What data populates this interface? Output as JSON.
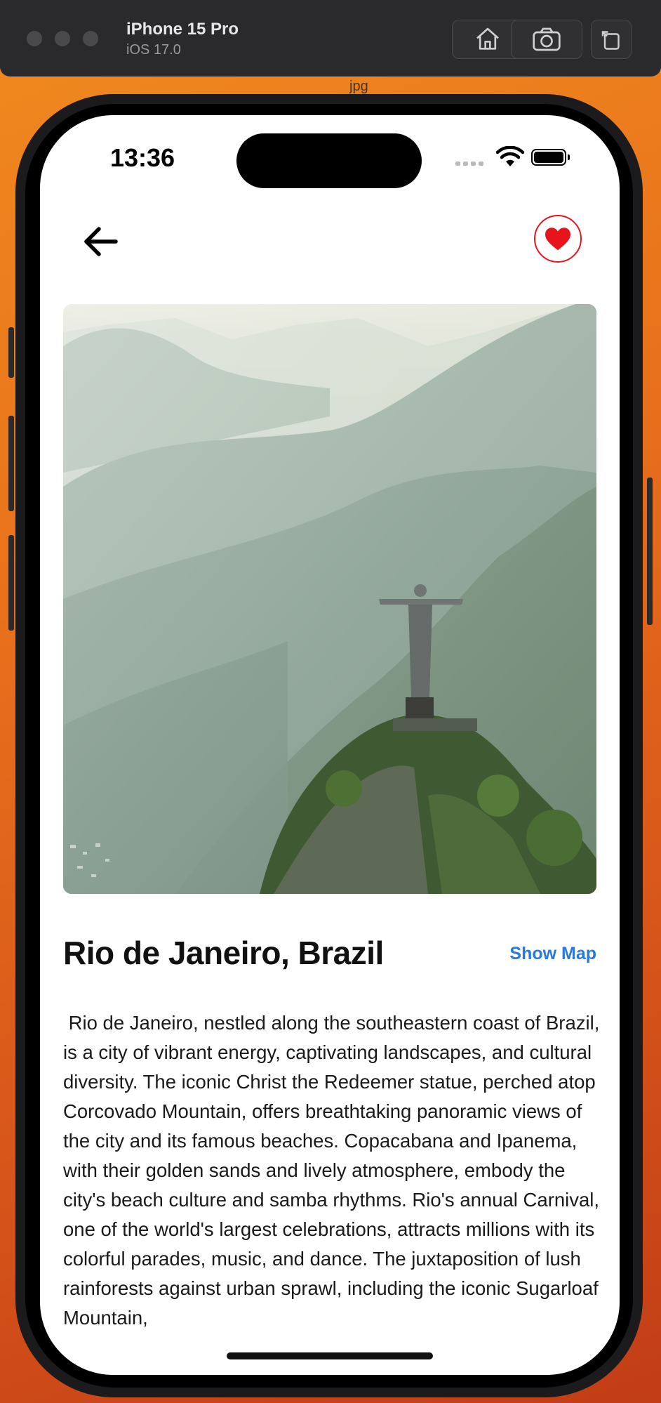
{
  "simulator": {
    "device_name": "iPhone 15 Pro",
    "os_version": "iOS 17.0",
    "file_label": "jpg"
  },
  "status_bar": {
    "time": "13:36"
  },
  "nav": {
    "back_icon": "arrow-left-icon",
    "favorite_icon": "heart-icon",
    "favorite_color": "#e8141c"
  },
  "destination": {
    "title": "Rio de Janeiro, Brazil",
    "show_map_label": "Show Map",
    "description": " Rio de Janeiro, nestled along the southeastern coast of Brazil, is a city of vibrant energy, captivating landscapes, and cultural diversity. The iconic Christ the Redeemer statue, perched atop Corcovado Mountain, offers breathtaking panoramic views of the city and its famous beaches. Copacabana and Ipanema, with their golden sands and lively atmosphere, embody the city's beach culture and samba rhythms. Rio's annual Carnival, one of the world's largest celebrations, attracts millions with its colorful parades, music, and dance. The juxtaposition of lush rainforests against urban sprawl, including the iconic Sugarloaf Mountain,"
  },
  "colors": {
    "accent": "#2a78e0",
    "heart": "#e8141c"
  }
}
